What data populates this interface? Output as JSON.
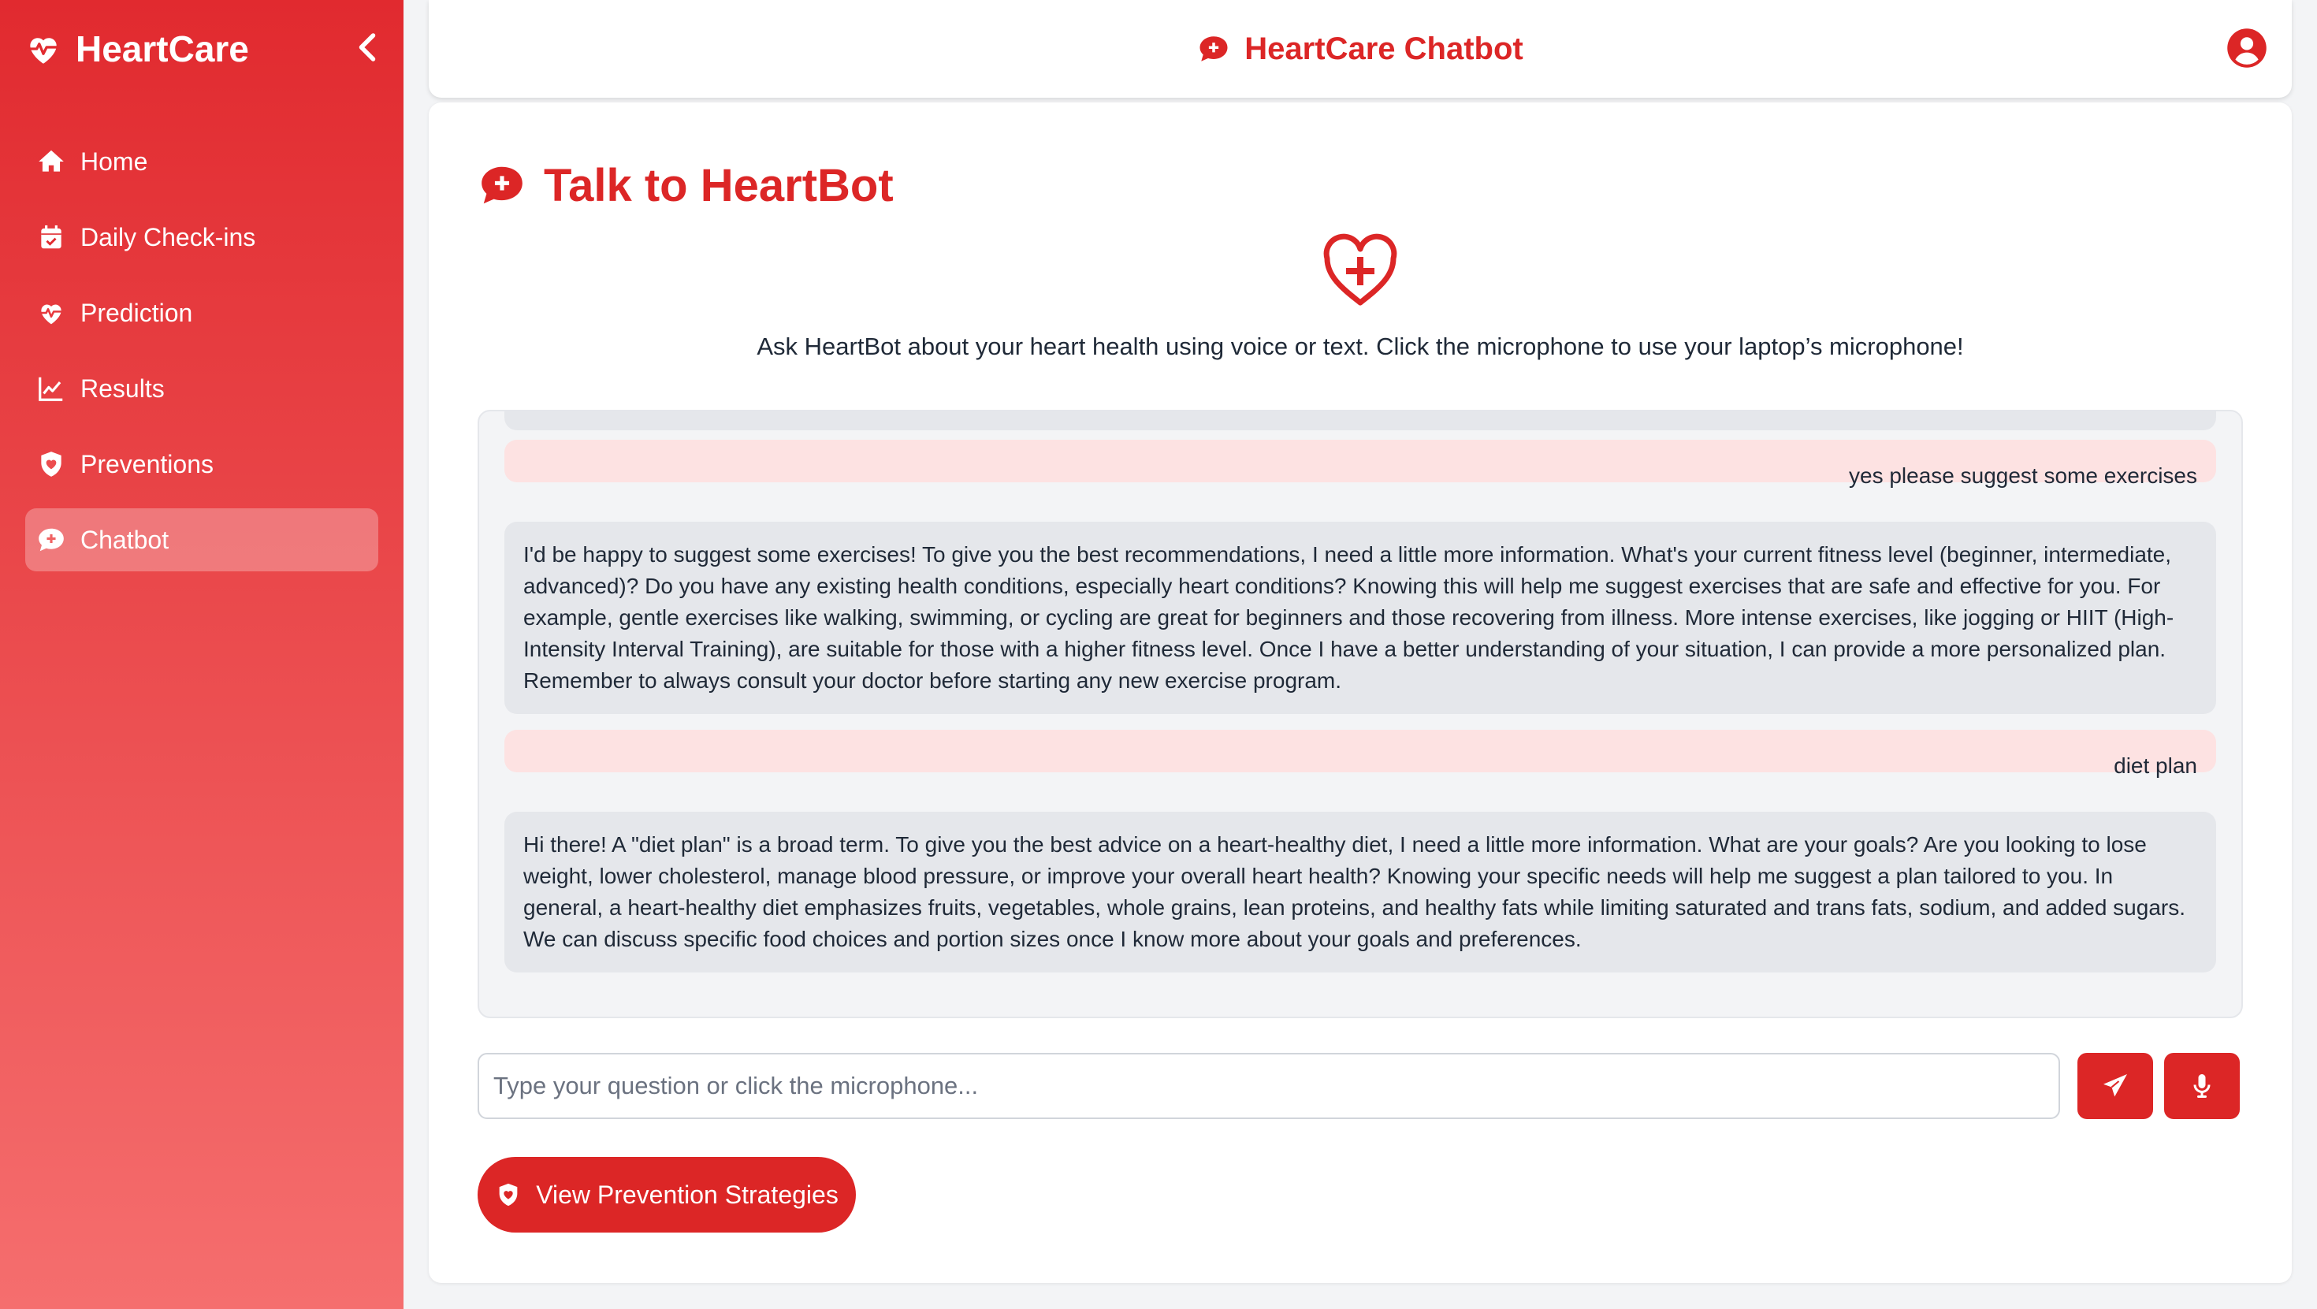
{
  "brand": {
    "name": "HeartCare"
  },
  "sidebar": {
    "items": [
      {
        "label": "Home",
        "icon": "home-icon"
      },
      {
        "label": "Daily Check-ins",
        "icon": "calendar-check-icon"
      },
      {
        "label": "Prediction",
        "icon": "heart-pulse-icon"
      },
      {
        "label": "Results",
        "icon": "chart-line-icon"
      },
      {
        "label": "Preventions",
        "icon": "shield-heart-icon"
      },
      {
        "label": "Chatbot",
        "icon": "comment-medical-icon",
        "active": true
      }
    ]
  },
  "header": {
    "title": "HeartCare Chatbot"
  },
  "page": {
    "title": "Talk to HeartBot",
    "intro": "Ask HeartBot about your heart health using voice or text. Click the microphone to use your laptop’s microphone!"
  },
  "chat": {
    "messages": [
      {
        "role": "user",
        "text": "yes please suggest some exercises"
      },
      {
        "role": "bot",
        "text": "I'd be happy to suggest some exercises! To give you the best recommendations, I need a little more information. What's your current fitness level (beginner, intermediate, advanced)? Do you have any existing health conditions, especially heart conditions? Knowing this will help me suggest exercises that are safe and effective for you. For example, gentle exercises like walking, swimming, or cycling are great for beginners and those recovering from illness. More intense exercises, like jogging or HIIT (High-Intensity Interval Training), are suitable for those with a higher fitness level. Once I have a better understanding of your situation, I can provide a more personalized plan. Remember to always consult your doctor before starting any new exercise program."
      },
      {
        "role": "user",
        "text": "diet plan"
      },
      {
        "role": "bot",
        "text": "Hi there! A \"diet plan\" is a broad term. To give you the best advice on a heart-healthy diet, I need a little more information. What are your goals? Are you looking to lose weight, lower cholesterol, manage blood pressure, or improve your overall heart health? Knowing your specific needs will help me suggest a plan tailored to you. In general, a heart-healthy diet emphasizes fruits, vegetables, whole grains, lean proteins, and healthy fats while limiting saturated and trans fats, sodium, and added sugars. We can discuss specific food choices and portion sizes once I know more about your goals and preferences."
      }
    ]
  },
  "input": {
    "placeholder": "Type your question or click the microphone..."
  },
  "prevention_button": {
    "label": "View Prevention Strategies"
  },
  "colors": {
    "accent": "#dc2626",
    "user_bubble": "#fde2e2",
    "bot_bubble": "#e5e7eb"
  }
}
